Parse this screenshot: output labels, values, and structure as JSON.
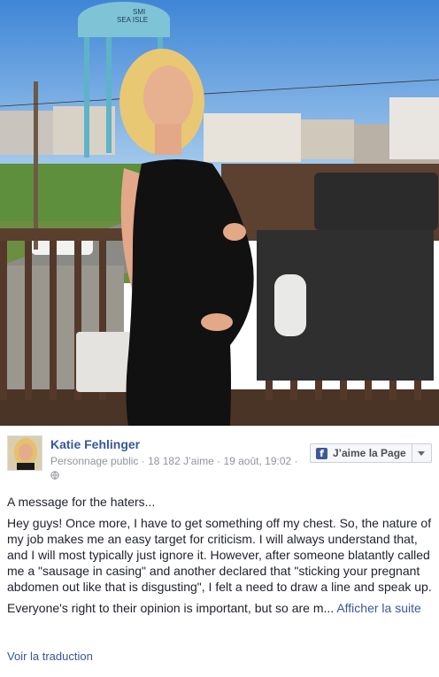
{
  "post": {
    "author": "Katie Fehlinger",
    "meta": "Personnage public · 18 182 J’aime · 19 août, 19:02 ·",
    "like_page_label": "J’aime la Page",
    "paragraphs": [
      "A message for the haters...",
      "Hey guys! Once more, I have to get something off my chest. So, the nature of my job makes me an easy target for criticism. I will always understand that, and I will most typically just ignore it. However, after someone blatantly called me a \"sausage in casing\" and another declared that \"sticking your pregnant abdomen out like that is disgusting\", I felt a need to draw a line and speak up."
    ],
    "truncated_text": "Everyone's right to their opinion is important, but so are m...",
    "see_more": "Afficher la suite",
    "translate": "Voir la traduction"
  },
  "photo": {
    "water_tower_text_1": "SMI",
    "water_tower_text_2": "SEA ISLE"
  },
  "colors": {
    "link": "#365899",
    "facebook_blue": "#3b5998",
    "meta_gray": "#90949c"
  }
}
